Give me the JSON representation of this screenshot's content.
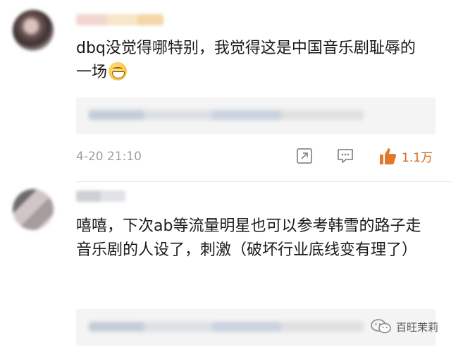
{
  "comments": [
    {
      "text": "dbq没觉得哪特别，我觉得这是中国音乐剧耻辱的一场",
      "emoji": "laugh-emoji",
      "timestamp": "4-20 21:10",
      "likes": "1.1万"
    },
    {
      "text": "嘻嘻，下次ab等流量明星也可以参考韩雪的路子走音乐剧的人设了，刺激（破坏行业底线变有理了）"
    }
  ],
  "actions": [
    "share-icon",
    "comment-icon",
    "like-icon"
  ],
  "colors": {
    "like": "#d86a1e",
    "text": "#1a1a1a",
    "meta": "#a0a0a0"
  },
  "watermark": {
    "icon": "wechat-icon",
    "text": "百旺茉莉"
  }
}
